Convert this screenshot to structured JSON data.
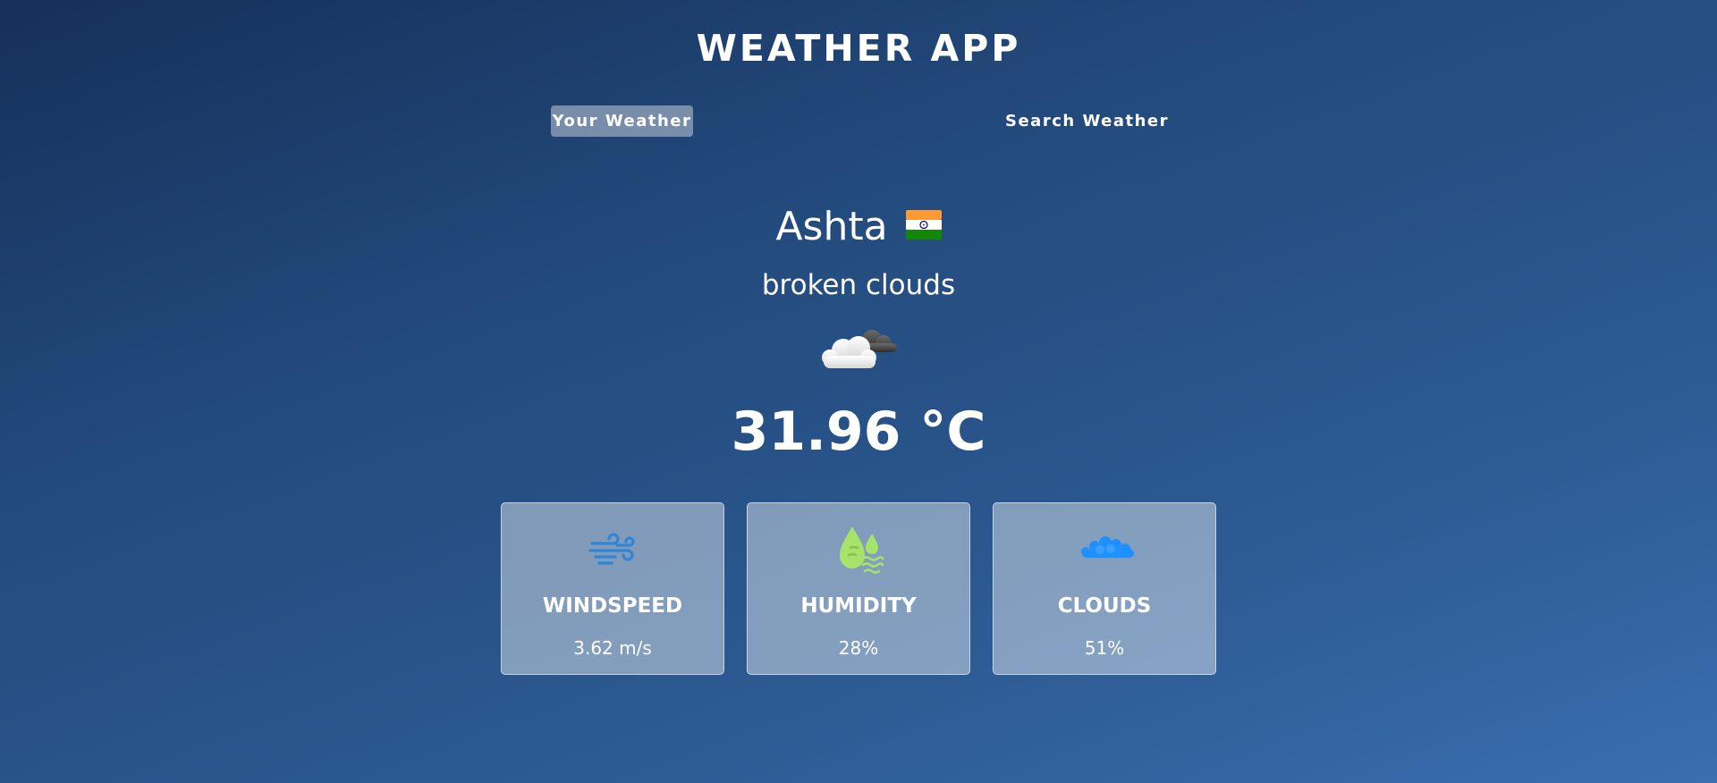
{
  "app": {
    "title": "WEATHER APP"
  },
  "tabs": {
    "your_weather": "Your Weather",
    "search_weather": "Search Weather",
    "active": "your_weather"
  },
  "location": {
    "city": "Ashta",
    "flag_icon": "india-flag-icon"
  },
  "weather": {
    "description": "broken clouds",
    "icon": "broken-clouds-icon",
    "temperature": "31.96 °C"
  },
  "stats": {
    "windspeed": {
      "label": "WINDSPEED",
      "value": "3.62 m/s",
      "icon": "wind-icon",
      "color": "#2f86d6"
    },
    "humidity": {
      "label": "HUMIDITY",
      "value": "28%",
      "icon": "humidity-drop-icon",
      "color": "#a6e36a"
    },
    "clouds": {
      "label": "CLOUDS",
      "value": "51%",
      "icon": "clouds-icon",
      "color": "#1e90ff"
    }
  }
}
